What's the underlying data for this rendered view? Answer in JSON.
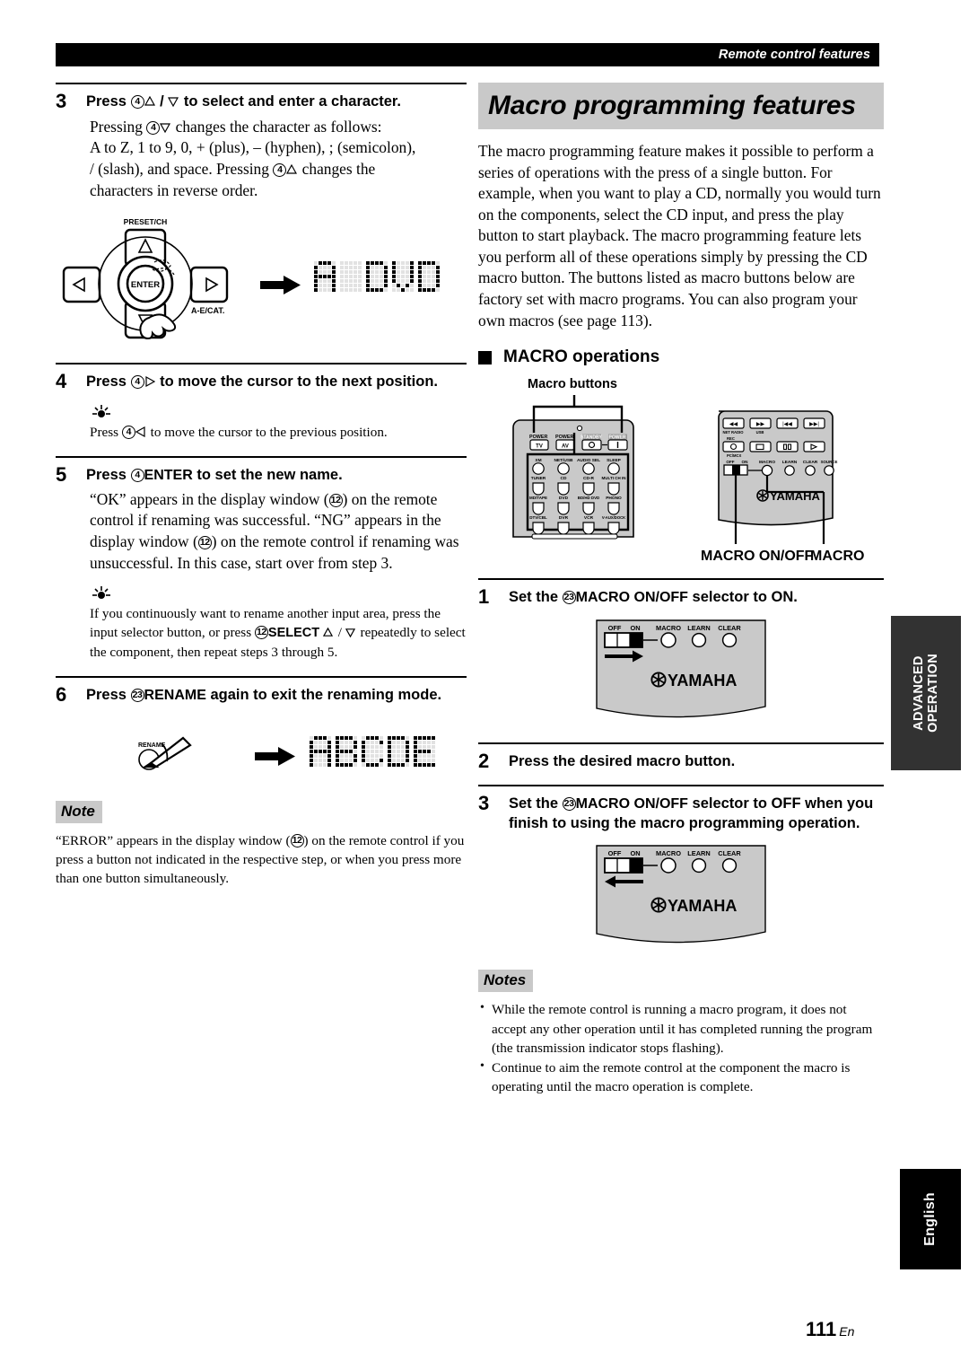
{
  "header": {
    "running_head": "Remote control features"
  },
  "left_column": {
    "step3": {
      "num": "3",
      "title_pre": "Press ",
      "title_circ": "4",
      "title_post": " to select and enter a character.",
      "body_l1_pre": "Pressing ",
      "body_l1_circ": "4",
      "body_l1_post": " changes the character as follows:",
      "body_l2": "A to Z, 1 to 9, 0, + (plus), – (hyphen), ; (semicolon),",
      "body_l3_pre": "/ (slash), and space. Pressing ",
      "body_l3_circ": "4",
      "body_l3_post": " changes the",
      "body_l4": "characters in reverse order.",
      "figure": {
        "pad_label": "PRESET/CH",
        "enter_label": "ENTER",
        "cat_label": "A-E/CAT.",
        "lcd_text": "A DVD"
      }
    },
    "step4": {
      "num": "4",
      "title_pre": "Press ",
      "title_circ": "4",
      "title_post": " to move the cursor to the next position.",
      "tip_pre": "Press ",
      "tip_circ": "4",
      "tip_post": " to move the cursor to the previous position."
    },
    "step5": {
      "num": "5",
      "title_pre": "Press ",
      "title_circ": "4",
      "title_bold": "ENTER",
      "title_post": " to set the new name.",
      "body": "“OK” appears in the display window (",
      "body_circ_1": "12",
      "body_2": ") on the remote control if renaming was successful. “NG” appears in the display window (",
      "body_circ_2": "12",
      "body_3": ") on the remote control if renaming was unsuccessful. In this case, start over from step 3.",
      "tip_1": "If you continuously want to rename another input area, press the input selector button, or press ",
      "tip_circ": "12",
      "tip_bold": "SELECT",
      "tip_2": " repeatedly to select the component, then repeat steps 3 through 5."
    },
    "step6": {
      "num": "6",
      "title_pre": "Press ",
      "title_circ": "23",
      "title_bold": "RENAME",
      "title_post": " again to exit the renaming mode.",
      "figure": {
        "button_label": "RENAME",
        "lcd_text": "ABCDE"
      }
    },
    "note": {
      "label": "Note",
      "text_1": "“ERROR” appears in the display window (",
      "circ": "12",
      "text_2": ") on the remote control if you press a button not indicated in the respective step, or when you press more than one button simultaneously."
    }
  },
  "right_column": {
    "title": "Macro programming features",
    "intro": "The macro programming feature makes it possible to perform a series of operations with the press of a single button. For example, when you want to play a CD, normally you would turn on the components, select the CD input, and press the play button to start playback. The macro programming feature lets you perform all of these operations simply by pressing the CD macro button. The buttons listed as macro buttons below are factory set with macro programs. You can also program your own macros (see page 113).",
    "section_heading": "MACRO operations",
    "macro_buttons_label": "Macro buttons",
    "remote_figure": {
      "left_remote": {
        "power_label_1": "POWER",
        "power_tv": "TV",
        "power_label_2": "POWER",
        "power_av": "AV",
        "stby_label": "STANDBY",
        "poweron_label": "POWER",
        "row1": [
          "XM",
          "NET/USB",
          "AUDIO SEL",
          "SLEEP"
        ],
        "row2": [
          "TUNER",
          "CD",
          "CD-R",
          "MULTI CH IN"
        ],
        "row3": [
          "MD/TAPE",
          "DVD",
          "BD/HD DVD",
          "PHONO"
        ],
        "row4": [
          "DTV/CBL",
          "DVR",
          "VCR",
          "V-AUX/DOCK"
        ]
      },
      "right_remote": {
        "transport_row1": [
          "NET RADIO",
          "USB",
          "",
          ""
        ],
        "transport_row2_label": "REC",
        "transport_row2_sub": "PC/MCX",
        "switch_off": "OFF",
        "switch_on": "ON",
        "btn_macro": "MACRO",
        "btn_learn": "LEARN",
        "btn_clear": "CLEAR",
        "btn_source": "SOURCE",
        "brand": "YAMAHA"
      },
      "caption_left": "MACRO ON/OFF",
      "caption_right": "MACRO"
    },
    "step1": {
      "num": "1",
      "title_pre": "Set the ",
      "title_circ": "23",
      "title_bold": "MACRO ON/OFF",
      "title_post": " selector to ON.",
      "figure": {
        "off": "OFF",
        "on": "ON",
        "macro": "MACRO",
        "learn": "LEARN",
        "clear": "CLEAR",
        "brand": "YAMAHA",
        "arrow_direction": "right"
      }
    },
    "step2": {
      "num": "2",
      "title": "Press the desired macro button."
    },
    "step3": {
      "num": "3",
      "title_pre": "Set the ",
      "title_circ": "23",
      "title_bold": "MACRO ON/OFF",
      "title_post": " selector to OFF when you finish to using the macro programming operation.",
      "figure": {
        "off": "OFF",
        "on": "ON",
        "macro": "MACRO",
        "learn": "LEARN",
        "clear": "CLEAR",
        "brand": "YAMAHA",
        "arrow_direction": "left"
      }
    },
    "notes": {
      "label": "Notes",
      "items": [
        "While the remote control is running a macro program, it does not accept any other operation until it has completed running the program (the transmission indicator stops flashing).",
        "Continue to aim the remote control at the component the macro is operating until the macro operation is complete."
      ]
    }
  },
  "side_tabs": {
    "advanced_line1": "ADVANCED",
    "advanced_line2": "OPERATION",
    "english": "English"
  },
  "footer": {
    "page_number": "111",
    "page_suffix": "En"
  },
  "colors": {
    "gray_band": "#c9c9c9",
    "tab_dark": "#323232",
    "black": "#000000"
  }
}
